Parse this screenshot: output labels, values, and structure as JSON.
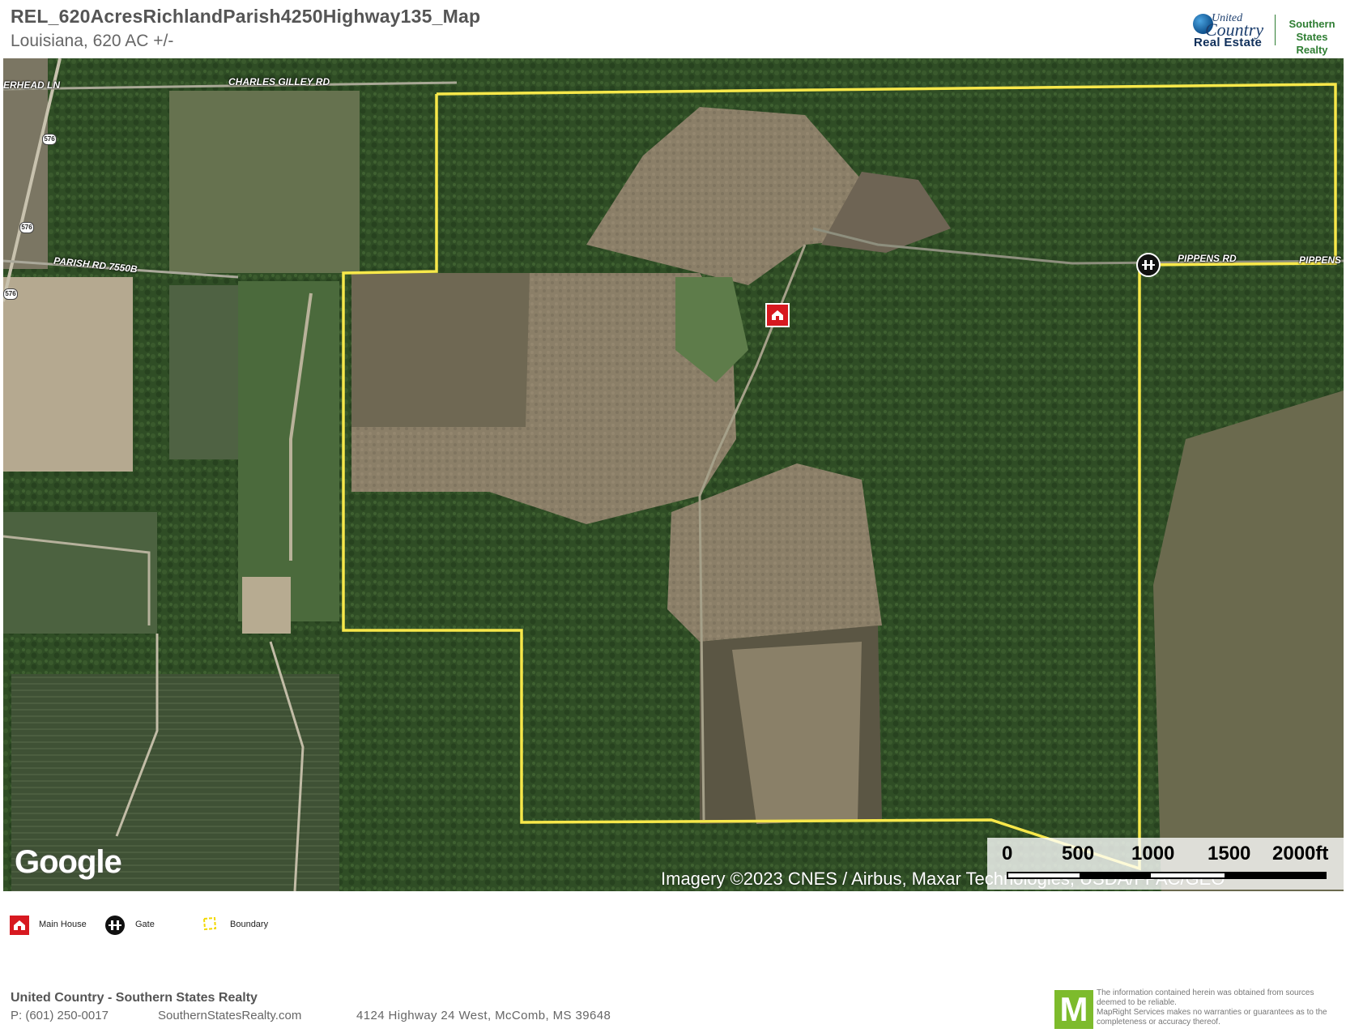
{
  "header": {
    "title": "REL_620AcresRichlandParish4250Highway135_Map",
    "subtitle": "Louisiana, 620 AC +/-",
    "logo": {
      "united": "United",
      "country": "Country",
      "real_estate": "Real Estate",
      "southern_line1": "Southern",
      "southern_line2": "States Realty"
    }
  },
  "map": {
    "road_labels": {
      "charles_gilley": "CHARLES GILLEY RD",
      "overhead": "ERHEAD LN",
      "parish_7550b": "PARISH RD 7550B",
      "pippens_1": "PIPPENS RD",
      "pippens_2": "PIPPENS"
    },
    "highway_shields": [
      "576",
      "576",
      "576"
    ],
    "markers": {
      "house_icon": "house-icon",
      "gate_icon": "gate-icon"
    },
    "google": "Google",
    "attribution": "Imagery ©2023 CNES / Airbus, Maxar Technologies, USDA/FPAC/GEO",
    "scale": {
      "labels": [
        "0",
        "500",
        "1000",
        "1500",
        "2000ft"
      ]
    },
    "colors": {
      "boundary": "#f7e84a",
      "house": "#d71920",
      "gate": "#111111"
    }
  },
  "legend": {
    "items": [
      {
        "label": "Main House",
        "icon": "house-icon"
      },
      {
        "label": "Gate",
        "icon": "gate-icon"
      },
      {
        "label": "Boundary",
        "icon": "boundary-icon"
      }
    ]
  },
  "footer": {
    "company": "United Country - Southern States Realty",
    "phone": "P: (601) 250-0017",
    "website": "SouthernStatesRealty.com",
    "address": "4124 Highway 24 West, McComb, MS 39648",
    "mapright_logo": "M",
    "disclaimer_1": "The information contained herein was obtained from sources deemed to be reliable.",
    "disclaimer_2": "MapRight Services makes no warranties or guarantees as to the completeness or accuracy thereof."
  }
}
